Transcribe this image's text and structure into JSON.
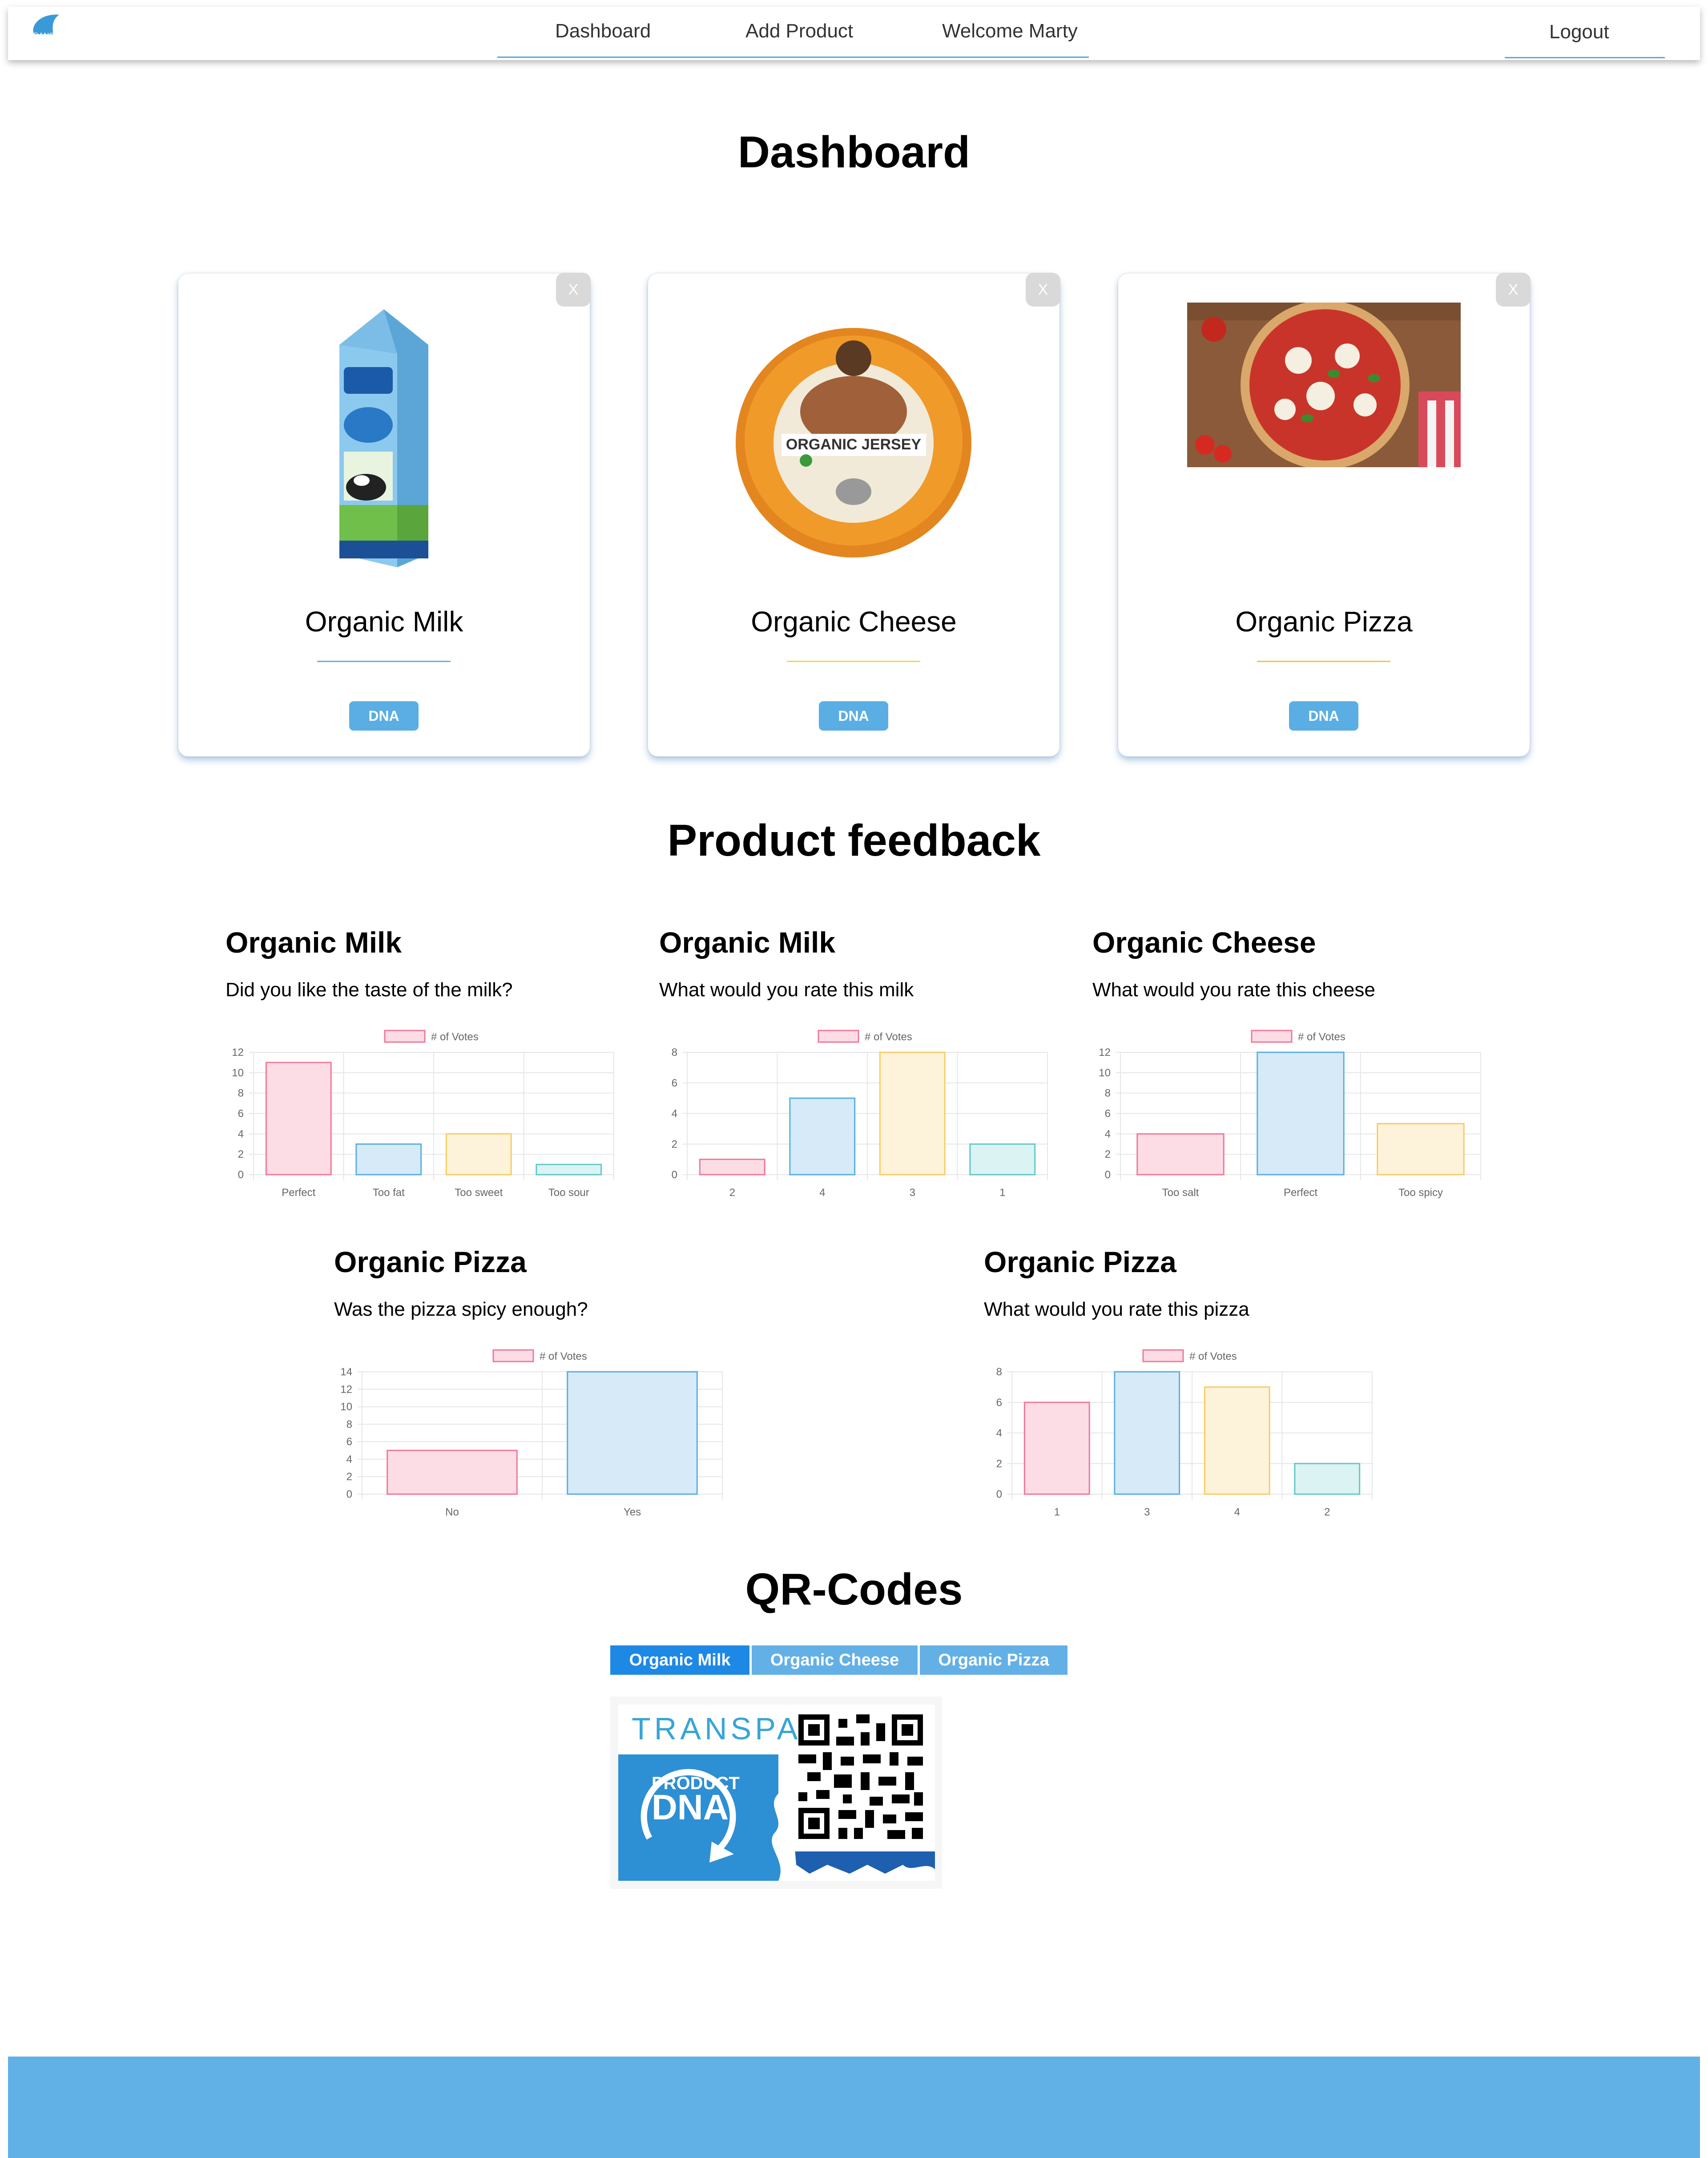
{
  "nav": {
    "logo_text": "TRANSPA",
    "links": [
      {
        "label": "Dashboard"
      },
      {
        "label": "Add Product"
      },
      {
        "label": "Welcome Marty"
      }
    ],
    "logout": "Logout"
  },
  "page_title": "Dashboard",
  "products": [
    {
      "name": "Organic Milk",
      "close": "X",
      "button": "DNA",
      "underline_color": "#5fb4dd"
    },
    {
      "name": "Organic Cheese",
      "close": "X",
      "button": "DNA",
      "underline_color": "#f3d44a"
    },
    {
      "name": "Organic Pizza",
      "close": "X",
      "button": "DNA",
      "underline_color": "#f0c640"
    }
  ],
  "feedback_title": "Product feedback",
  "feedback": [
    {
      "product": "Organic Milk",
      "question": "Did you like the taste of the milk?"
    },
    {
      "product": "Organic Milk",
      "question": "What would you rate this milk"
    },
    {
      "product": "Organic Cheese",
      "question": "What would you rate this cheese"
    },
    {
      "product": "Organic Pizza",
      "question": "Was the pizza spicy enough?"
    },
    {
      "product": "Organic Pizza",
      "question": "What would you rate this pizza"
    }
  ],
  "chart_data": [
    {
      "type": "bar",
      "legend": "# of Votes",
      "categories": [
        "Perfect",
        "Too fat",
        "Too sweet",
        "Too sour"
      ],
      "series": [
        {
          "name": "# of Votes",
          "values": [
            11,
            3,
            4,
            1
          ]
        }
      ],
      "ylim": [
        0,
        12
      ],
      "yticks": [
        0,
        2,
        4,
        6,
        8,
        10,
        12
      ],
      "grid": true,
      "legend_position": "top"
    },
    {
      "type": "bar",
      "legend": "# of Votes",
      "categories": [
        "2",
        "4",
        "3",
        "1"
      ],
      "series": [
        {
          "name": "# of Votes",
          "values": [
            1,
            5,
            8,
            2
          ]
        }
      ],
      "ylim": [
        0,
        8
      ],
      "yticks": [
        0,
        2,
        4,
        6,
        8
      ],
      "grid": true,
      "legend_position": "top"
    },
    {
      "type": "bar",
      "legend": "# of Votes",
      "categories": [
        "Too salt",
        "Perfect",
        "Too spicy"
      ],
      "series": [
        {
          "name": "# of Votes",
          "values": [
            4,
            12,
            5
          ]
        }
      ],
      "ylim": [
        0,
        12
      ],
      "yticks": [
        0,
        2,
        4,
        6,
        8,
        10,
        12
      ],
      "grid": true,
      "legend_position": "top"
    },
    {
      "type": "bar",
      "legend": "# of Votes",
      "categories": [
        "No",
        "Yes"
      ],
      "series": [
        {
          "name": "# of Votes",
          "values": [
            5,
            14
          ]
        }
      ],
      "ylim": [
        0,
        14
      ],
      "yticks": [
        0,
        2,
        4,
        6,
        8,
        10,
        12,
        14
      ],
      "grid": true,
      "legend_position": "top"
    },
    {
      "type": "bar",
      "legend": "# of Votes",
      "categories": [
        "1",
        "3",
        "4",
        "2"
      ],
      "series": [
        {
          "name": "# of Votes",
          "values": [
            6,
            8,
            7,
            2
          ]
        }
      ],
      "ylim": [
        0,
        8
      ],
      "yticks": [
        0,
        2,
        4,
        6,
        8
      ],
      "grid": true,
      "legend_position": "top"
    }
  ],
  "bar_colors": [
    {
      "fill": "#fddde5",
      "stroke": "#f07898"
    },
    {
      "fill": "#d6eaf8",
      "stroke": "#5aaee3"
    },
    {
      "fill": "#fdf3da",
      "stroke": "#f6cd64"
    },
    {
      "fill": "#dcf3f3",
      "stroke": "#62c8c8"
    }
  ],
  "qr_title": "QR-Codes",
  "qr_tabs": [
    {
      "label": "Organic Milk",
      "active": true
    },
    {
      "label": "Organic Cheese",
      "active": false
    },
    {
      "label": "Organic Pizza",
      "active": false
    }
  ],
  "qr_card": {
    "brand": "TRANSPA",
    "line1": "PRODUCT",
    "line2": "DNA"
  },
  "colors": {
    "accent": "#5aaee3",
    "tab_active": "#1e88e5",
    "tab_inactive": "#63b0e6",
    "footer": "#62b1e6"
  }
}
